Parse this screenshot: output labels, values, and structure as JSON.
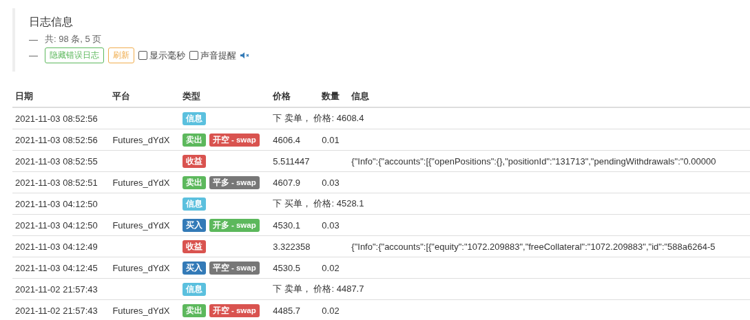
{
  "panel": {
    "title": "日志信息",
    "summary_dash": "—",
    "summary": "共: 98 条, 5 页",
    "controls_dash": "—",
    "buttons": [
      {
        "label": "隐藏错误日志",
        "color": "#5cb85c"
      },
      {
        "label": "刷新",
        "color": "#f0ad4e"
      }
    ],
    "checkboxes": [
      {
        "label": "显示毫秒",
        "checked": false
      },
      {
        "label": "声音提醒",
        "checked": false
      }
    ],
    "sound_muted": true
  },
  "table": {
    "columns": [
      "日期",
      "平台",
      "类型",
      "价格",
      "数量",
      "信息"
    ],
    "rows": [
      {
        "date": "2021-11-03 08:52:56",
        "tags": [
          {
            "label": "信息",
            "color": "#5bc0de"
          }
        ],
        "message": "下 卖单， 价格:  4608.4"
      },
      {
        "date": "2021-11-03 08:52:56",
        "platform": "Futures_dYdX",
        "tags": [
          {
            "label": "卖出",
            "color": "#5cb85c"
          },
          {
            "label": "开空 - swap",
            "color": "#d9534f"
          }
        ],
        "price": "4606.4",
        "amount": "0.01"
      },
      {
        "date": "2021-11-03 08:52:55",
        "tags": [
          {
            "label": "收益",
            "color": "#d9534f"
          }
        ],
        "price": "5.511447",
        "info": "{\"Info\":{\"accounts\":[{\"openPositions\":{},\"positionId\":\"131713\",\"pendingWithdrawals\":\"0.00000"
      },
      {
        "date": "2021-11-03 08:52:51",
        "platform": "Futures_dYdX",
        "tags": [
          {
            "label": "卖出",
            "color": "#5cb85c"
          },
          {
            "label": "平多 - swap",
            "color": "#777777"
          }
        ],
        "price": "4607.9",
        "amount": "0.03"
      },
      {
        "date": "2021-11-03 04:12:50",
        "tags": [
          {
            "label": "信息",
            "color": "#5bc0de"
          }
        ],
        "message": "下 买单， 价格:  4528.1"
      },
      {
        "date": "2021-11-03 04:12:50",
        "platform": "Futures_dYdX",
        "tags": [
          {
            "label": "买入",
            "color": "#337ab7"
          },
          {
            "label": "开多 - swap",
            "color": "#5cb85c"
          }
        ],
        "price": "4530.1",
        "amount": "0.03"
      },
      {
        "date": "2021-11-03 04:12:49",
        "tags": [
          {
            "label": "收益",
            "color": "#d9534f"
          }
        ],
        "price": "3.322358",
        "info": "{\"Info\":{\"accounts\":[{\"equity\":\"1072.209883\",\"freeCollateral\":\"1072.209883\",\"id\":\"588a6264-5"
      },
      {
        "date": "2021-11-03 04:12:45",
        "platform": "Futures_dYdX",
        "tags": [
          {
            "label": "买入",
            "color": "#337ab7"
          },
          {
            "label": "平空 - swap",
            "color": "#777777"
          }
        ],
        "price": "4530.5",
        "amount": "0.02"
      },
      {
        "date": "2021-11-02 21:57:43",
        "tags": [
          {
            "label": "信息",
            "color": "#5bc0de"
          }
        ],
        "message": "下 卖单， 价格:  4487.7"
      },
      {
        "date": "2021-11-02 21:57:43",
        "platform": "Futures_dYdX",
        "tags": [
          {
            "label": "卖出",
            "color": "#5cb85c"
          },
          {
            "label": "开空 - swap",
            "color": "#d9534f"
          }
        ],
        "price": "4485.7",
        "amount": "0.02"
      }
    ]
  }
}
